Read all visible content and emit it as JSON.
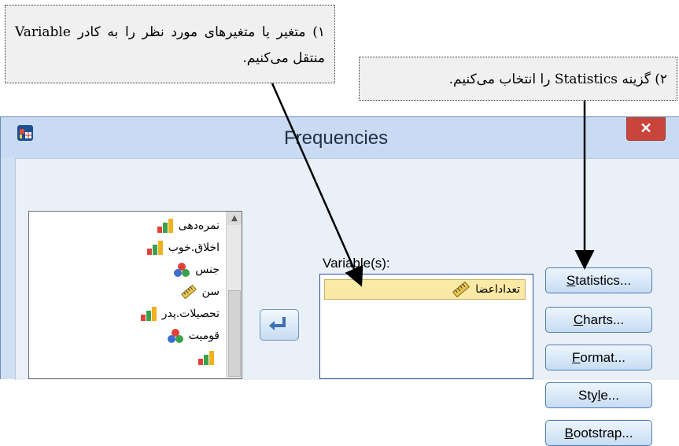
{
  "annotations": {
    "step1": "۱) متغیر یا متغیرهای مورد نظر را به کادر Variable منتقل می‌کنیم.",
    "step2": "۲) گزینه Statistics را انتخاب می‌کنیم."
  },
  "dialog": {
    "title": "Frequencies",
    "close_label": "✕",
    "variables_label": "Variable(s):",
    "source_variables": [
      {
        "label": "نمره‌دهی",
        "icon": "ordinal-bar-icon"
      },
      {
        "label": "اخلاق.خوب",
        "icon": "ordinal-bar-icon"
      },
      {
        "label": "جنس",
        "icon": "nominal-circles-icon"
      },
      {
        "label": "سن",
        "icon": "scale-ruler-icon"
      },
      {
        "label": "تحصیلات.پدر",
        "icon": "ordinal-bar-icon"
      },
      {
        "label": "قومیت",
        "icon": "nominal-circles-icon"
      },
      {
        "label": "",
        "icon": "ordinal-bar-icon"
      }
    ],
    "selected_variables": [
      {
        "label": "تعداداعضا",
        "icon": "scale-ruler-icon"
      }
    ],
    "buttons": [
      {
        "pre": "",
        "u": "S",
        "post": "tatistics..."
      },
      {
        "pre": "",
        "u": "C",
        "post": "harts..."
      },
      {
        "pre": "",
        "u": "F",
        "post": "ormat..."
      },
      {
        "pre": "Sty",
        "u": "l",
        "post": "e..."
      },
      {
        "pre": "",
        "u": "B",
        "post": "ootstrap..."
      }
    ]
  },
  "colors": {
    "dialog_frame": "#c8dbf2",
    "close_button": "#c9453c",
    "selected_row": "#fbe9a6",
    "button_border": "#4c7db5"
  }
}
